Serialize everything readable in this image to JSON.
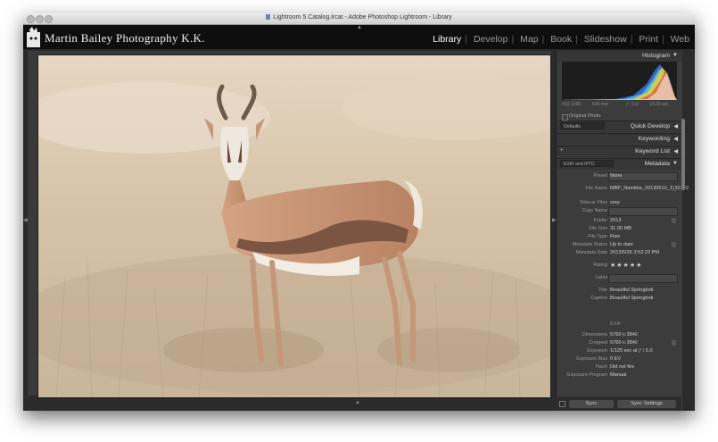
{
  "window": {
    "title": "Lightroom 5 Catalog.lrcat - Adobe Photoshop Lightroom - Library"
  },
  "identity_plate": {
    "brand": "Martin Bailey Photography K.K."
  },
  "modules": [
    "Library",
    "Develop",
    "Map",
    "Book",
    "Slideshow",
    "Print",
    "Web"
  ],
  "active_module": "Library",
  "photo": {
    "subject": "springbok",
    "colors": {
      "background": "#d9c9b2",
      "coat": "#c9987a",
      "belly": "#f4efe8"
    }
  },
  "histogram": {
    "title": "Histogram",
    "iso": "ISO 1000",
    "focal": "600 mm",
    "aperture": "ƒ / 5.0",
    "shutter": "1/125 sec",
    "original_photo": "Original Photo"
  },
  "panels": {
    "quick_develop": "Quick Develop",
    "keywording": "Keywording",
    "keyword_list": "Keyword List",
    "metadata": "Metadata",
    "defaults": "Defaults",
    "exif_iptc": "EXIF and IPTC"
  },
  "metadata": {
    "preset_label": "Preset",
    "preset_value": "None",
    "file_name_label": "File Name",
    "file_name_value": "MBP_Namibia_20130510_1142.cr2",
    "sidecar_label": "Sidecar Files",
    "sidecar_value": "xmp",
    "copy_name_label": "Copy Name",
    "folder_label": "Folder",
    "folder_value": "2013",
    "file_size_label": "File Size",
    "file_size_value": "31.95 MB",
    "file_type_label": "File Type",
    "file_type_value": "Raw",
    "status_label": "Metadata Status",
    "status_value": "Up to date",
    "date_label": "Metadata Date",
    "date_value": "2013/5/26 3:52:22 PM",
    "rating_label": "Rating",
    "rating_value": "★★★★★",
    "label_label": "Label",
    "title_label": "Title",
    "title_value": "Beautiful Springbok",
    "caption_label": "Caption",
    "caption_value": "Beautiful Springbok",
    "exif_heading": "EXIF",
    "dimensions_label": "Dimensions",
    "dimensions_value": "5760 x 3840",
    "cropped_label": "Cropped",
    "cropped_value": "5760 x 3840",
    "exposure_label": "Exposure",
    "exposure_value": "1/125 sec at ƒ / 5.0",
    "bias_label": "Exposure Bias",
    "bias_value": "0 EV",
    "flash_label": "Flash",
    "flash_value": "Did not fire",
    "program_label": "Exposure Program",
    "program_value": "Manual"
  },
  "buttons": {
    "sync": "Sync",
    "sync_settings": "Sync Settings"
  }
}
